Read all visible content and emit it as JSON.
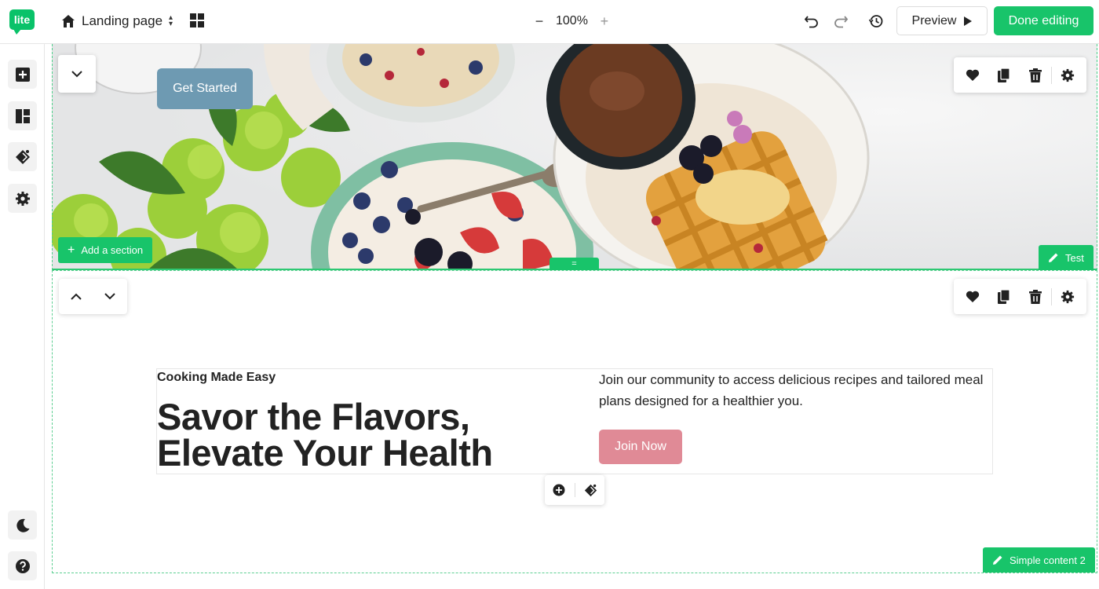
{
  "app": {
    "logo_text": "lite",
    "page_name": "Landing page",
    "zoom_minus": "−",
    "zoom_level": "100%",
    "zoom_plus": "+",
    "preview_label": "Preview",
    "done_label": "Done editing",
    "brand_color": "#18c46a"
  },
  "sidebar": {
    "top_items": [
      "add-block-icon",
      "layout-icon",
      "paint-icon",
      "settings-icon"
    ],
    "bottom_items": [
      "moon-icon",
      "help-icon"
    ]
  },
  "hero": {
    "cta_label": "Get Started",
    "add_section_label": "Add a section",
    "section_tag": "Test",
    "handle_glyph": "="
  },
  "section2": {
    "eyebrow": "Cooking Made Easy",
    "headline": "Savor the Flavors, Elevate Your Health",
    "paragraph": "Join our community to access delicious recipes and tailored meal plans designed for a healthier you.",
    "cta_label": "Join Now",
    "section_tag": "Simple content 2"
  },
  "colors": {
    "get_started_bg": "#6e9ab2",
    "join_now_bg": "#e08a96"
  }
}
